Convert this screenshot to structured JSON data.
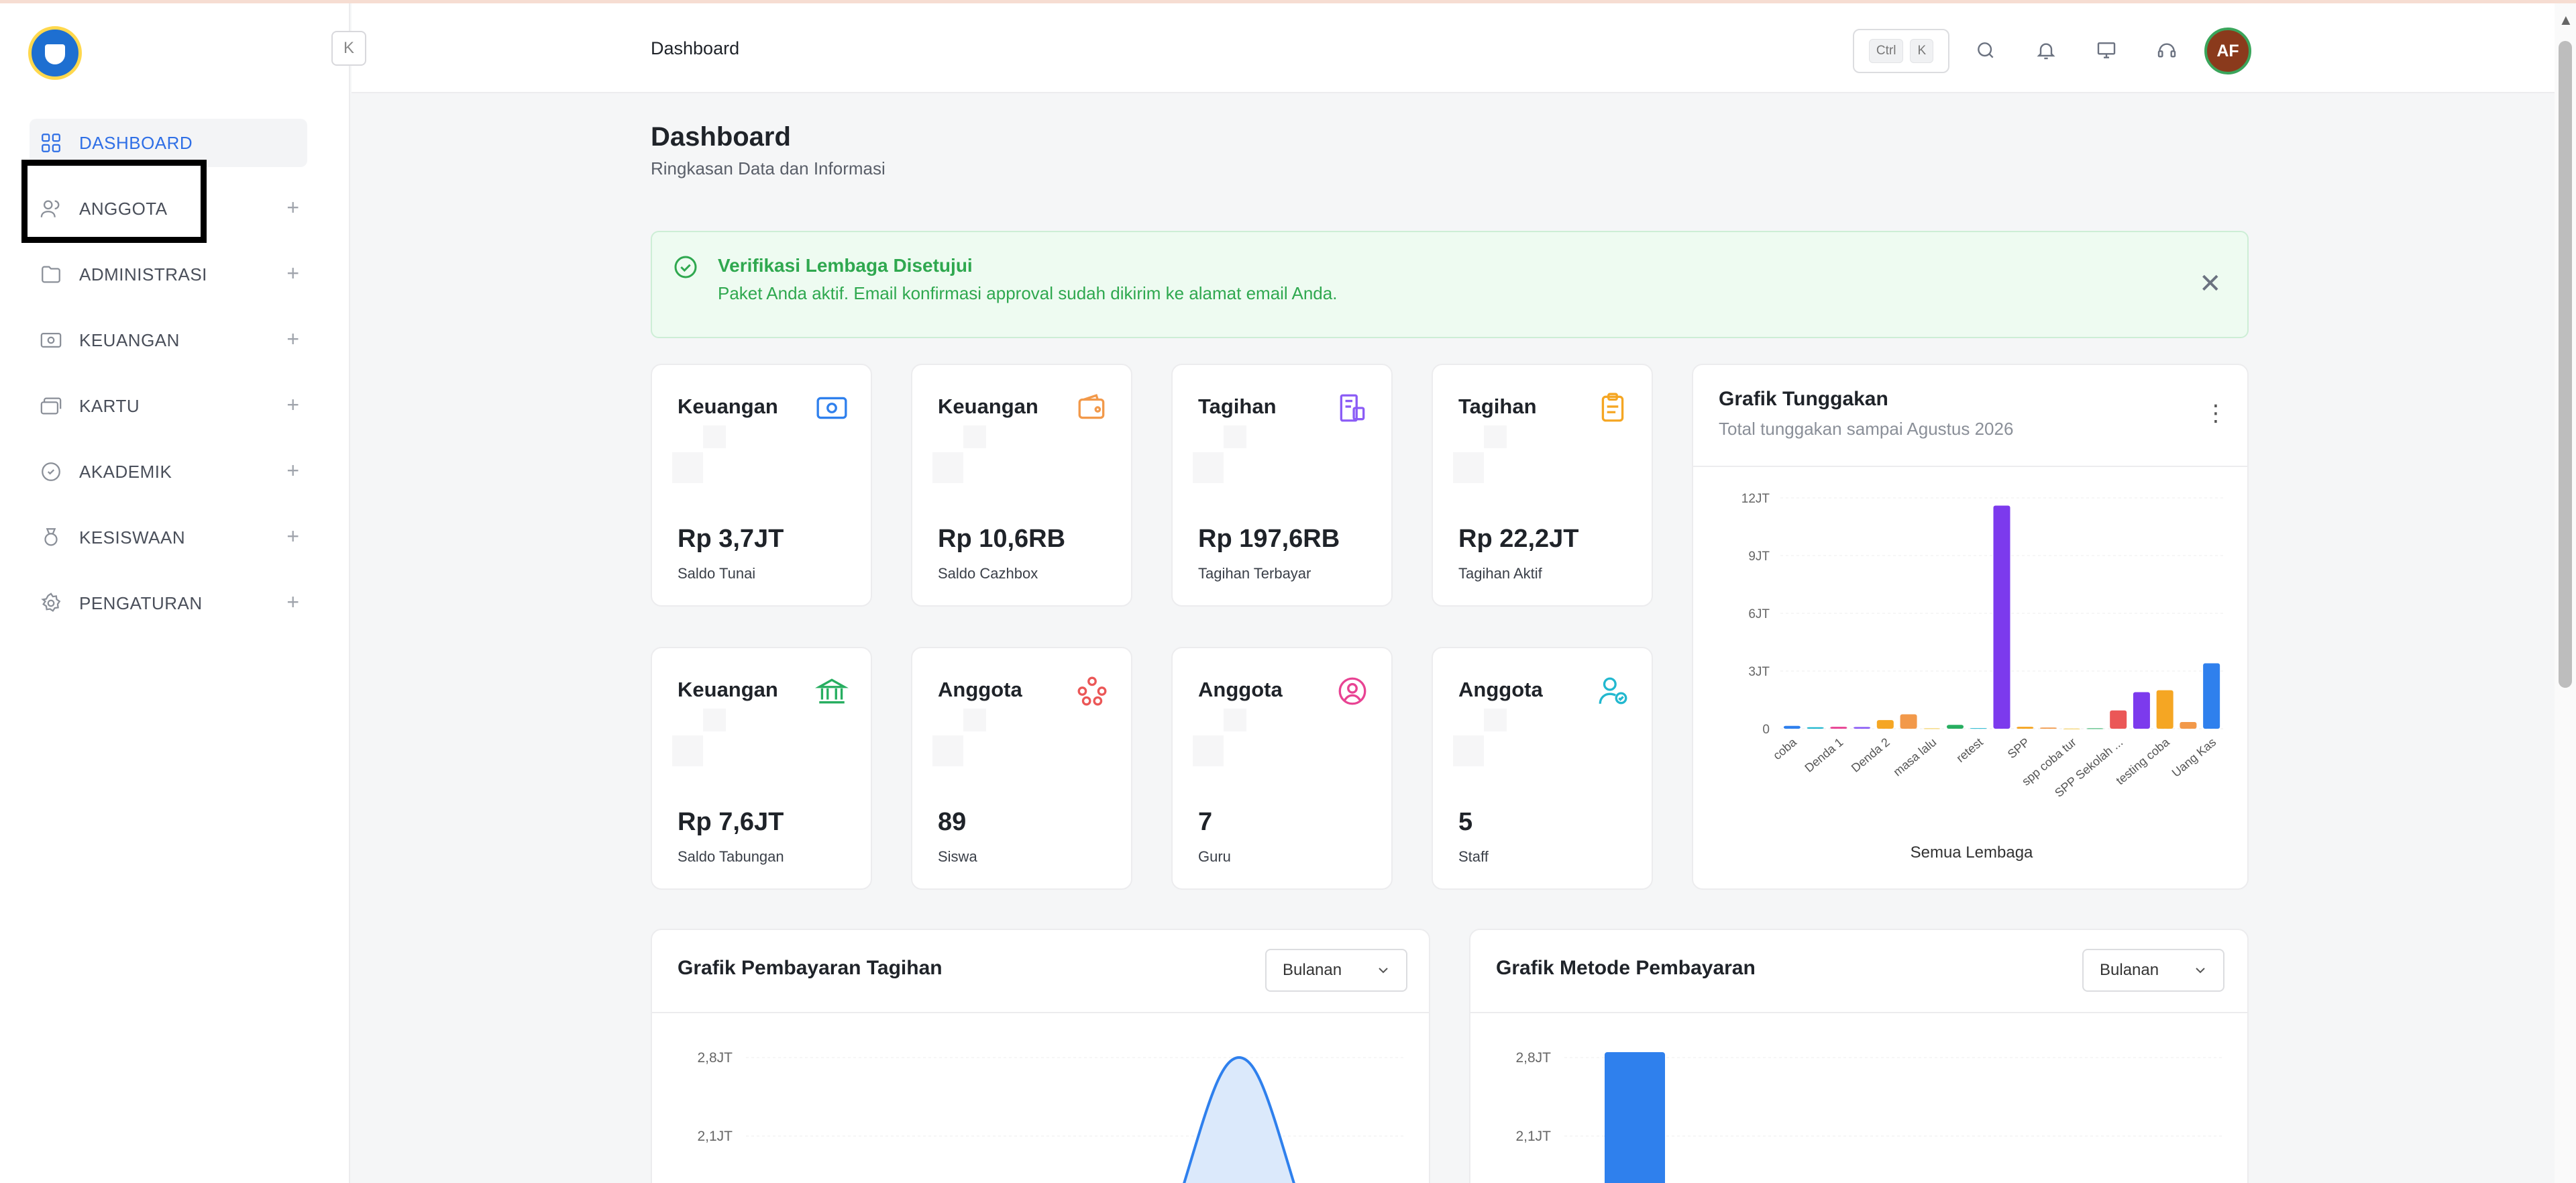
{
  "sidebar": {
    "items": [
      {
        "label": "DASHBOARD",
        "active": true,
        "icon": "grid-icon"
      },
      {
        "label": "ANGGOTA",
        "icon": "users-icon"
      },
      {
        "label": "ADMINISTRASI",
        "icon": "folder-icon"
      },
      {
        "label": "KEUANGAN",
        "icon": "cash-icon"
      },
      {
        "label": "KARTU",
        "icon": "cards-icon"
      },
      {
        "label": "AKADEMIK",
        "icon": "badge-icon"
      },
      {
        "label": "KESISWAAN",
        "icon": "medal-icon"
      },
      {
        "label": "PENGATURAN",
        "icon": "gear-icon"
      }
    ],
    "collapse_label": "K"
  },
  "header": {
    "breadcrumb": "Dashboard",
    "shortcut": {
      "key1": "Ctrl",
      "key2": "K"
    },
    "avatar_initials": "AF"
  },
  "page": {
    "title": "Dashboard",
    "subtitle": "Ringkasan Data dan Informasi"
  },
  "alert": {
    "title": "Verifikasi Lembaga Disetujui",
    "message": "Paket Anda aktif. Email konfirmasi approval sudah dikirim ke alamat email Anda.",
    "color": "#2fa84f"
  },
  "stats": [
    {
      "label": "Keuangan",
      "value": "Rp 3,7JT",
      "caption": "Saldo Tunai",
      "icon": "cash-icon",
      "color": "#2f80ed"
    },
    {
      "label": "Keuangan",
      "value": "Rp 10,6RB",
      "caption": "Saldo Cazhbox",
      "icon": "wallet-icon",
      "color": "#f2994a"
    },
    {
      "label": "Tagihan",
      "value": "Rp 197,6RB",
      "caption": "Tagihan Terbayar",
      "icon": "receipt-icon",
      "color": "#8b5cf6"
    },
    {
      "label": "Tagihan",
      "value": "Rp 22,2JT",
      "caption": "Tagihan Aktif",
      "icon": "clipboard-icon",
      "color": "#f5a623"
    },
    {
      "label": "Keuangan",
      "value": "Rp 7,6JT",
      "caption": "Saldo Tabungan",
      "icon": "bank-icon",
      "color": "#27ae60"
    },
    {
      "label": "Anggota",
      "value": "89",
      "caption": "Siswa",
      "icon": "group-icon",
      "color": "#eb5757"
    },
    {
      "label": "Anggota",
      "value": "7",
      "caption": "Guru",
      "icon": "user-circle-icon",
      "color": "#e84393"
    },
    {
      "label": "Anggota",
      "value": "5",
      "caption": "Staff",
      "icon": "user-check-icon",
      "color": "#22b8cf"
    }
  ],
  "tunggakan": {
    "title": "Grafik Tunggakan",
    "subtitle": "Total tunggakan sampai Agustus 2026",
    "xlabel": "Semua Lembaga"
  },
  "pembayaran": {
    "title": "Grafik Pembayaran Tagihan",
    "period": "Bulanan"
  },
  "metode": {
    "title": "Grafik Metode Pembayaran",
    "period": "Bulanan"
  },
  "chart_data": [
    {
      "type": "bar",
      "title": "Grafik Tunggakan",
      "xlabel": "Semua Lembaga",
      "ylabel": "",
      "ylim": [
        0,
        12000000
      ],
      "yticks": [
        "0",
        "3JT",
        "6JT",
        "9JT",
        "12JT"
      ],
      "categories": [
        "coba",
        "",
        "Denda 1",
        "",
        "Denda 2",
        "",
        "masa lalu",
        "",
        "retest",
        "",
        "SPP",
        "",
        "spp coba tur",
        "",
        "SPP Sekolah ...",
        "",
        "testing coba",
        "",
        "Uang Kas"
      ],
      "values": [
        150000,
        80000,
        100000,
        90000,
        450000,
        750000,
        20000,
        200000,
        30000,
        11600000,
        100000,
        60000,
        10000,
        20000,
        950000,
        1900000,
        2000000,
        350000,
        3400000
      ],
      "colors": [
        "#2f80ed",
        "#22b8cf",
        "#e84393",
        "#8b5cf6",
        "#f5a623",
        "#f2994a",
        "#f2c94c",
        "#27ae60",
        "#22b8cf",
        "#7c3aed",
        "#f5a623",
        "#f2994a",
        "#f2c94c",
        "#27ae60",
        "#eb5757",
        "#7c3aed",
        "#f5a623",
        "#f2994a",
        "#2f80ed"
      ],
      "grid": true
    },
    {
      "type": "area",
      "title": "Grafik Pembayaran Tagihan",
      "yticks": [
        "2,8JT",
        "2,1JT"
      ],
      "x": [
        0,
        1,
        2,
        3,
        4,
        5,
        6,
        7
      ],
      "values": [
        0,
        0,
        0,
        0,
        0,
        0,
        2800000,
        0
      ],
      "grid": true
    },
    {
      "type": "bar",
      "title": "Grafik Metode Pembayaran",
      "yticks": [
        "2,8JT",
        "2,1JT"
      ],
      "categories": [
        ""
      ],
      "values": [
        2800000
      ],
      "colors": [
        "#2f80ed"
      ],
      "grid": true
    }
  ]
}
